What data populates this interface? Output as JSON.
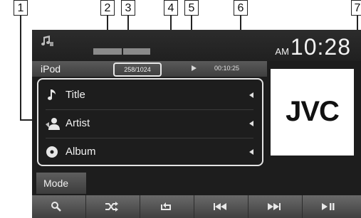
{
  "callouts": [
    "1",
    "2",
    "3",
    "4",
    "5",
    "6",
    "7"
  ],
  "screen": {
    "source": "iPod",
    "track_count": "258/1024",
    "elapsed": "00:10:25",
    "clock": {
      "ampm": "AM",
      "time": "10:28"
    },
    "rows": [
      {
        "label": "Title",
        "icon": "note-icon"
      },
      {
        "label": "Artist",
        "icon": "artist-icon"
      },
      {
        "label": "Album",
        "icon": "album-icon"
      }
    ],
    "artwork_text": "JVC",
    "mode_label": "Mode",
    "controls": [
      "search-icon",
      "shuffle-icon",
      "repeat-icon",
      "previous-icon",
      "next-icon",
      "play-pause-icon"
    ]
  },
  "colors": {
    "screen_bg": "#1d1d1d",
    "text": "#f2f2f2",
    "panel_border": "#e4e4e4"
  }
}
